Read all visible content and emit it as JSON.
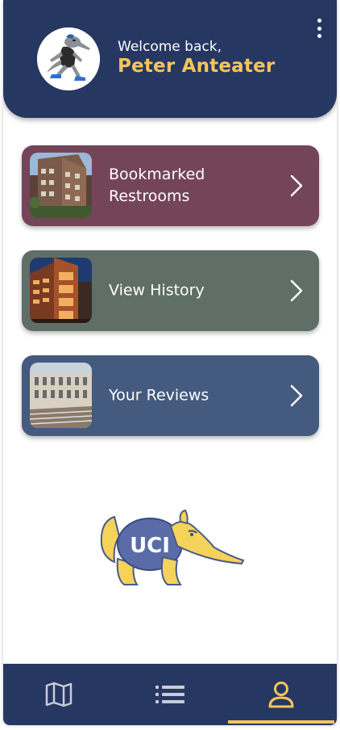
{
  "header": {
    "welcome": "Welcome back,",
    "username": "Peter Anteater",
    "menu_icon": "kebab-menu-icon"
  },
  "cards": [
    {
      "label": "Bookmarked Restrooms",
      "color": "#744458",
      "icon": "chevron-right-icon"
    },
    {
      "label": "View History",
      "color": "#5f6e66",
      "icon": "chevron-right-icon"
    },
    {
      "label": "Your Reviews",
      "color": "#445a7e",
      "icon": "chevron-right-icon"
    }
  ],
  "mascot_text": "UCI",
  "nav": {
    "items": [
      {
        "name": "map",
        "icon": "map-icon"
      },
      {
        "name": "list",
        "icon": "list-icon"
      },
      {
        "name": "profile",
        "icon": "person-icon",
        "active": true
      }
    ],
    "active_color": "#f7c55b"
  },
  "colors": {
    "primary": "#263762",
    "accent": "#f7c55b"
  }
}
